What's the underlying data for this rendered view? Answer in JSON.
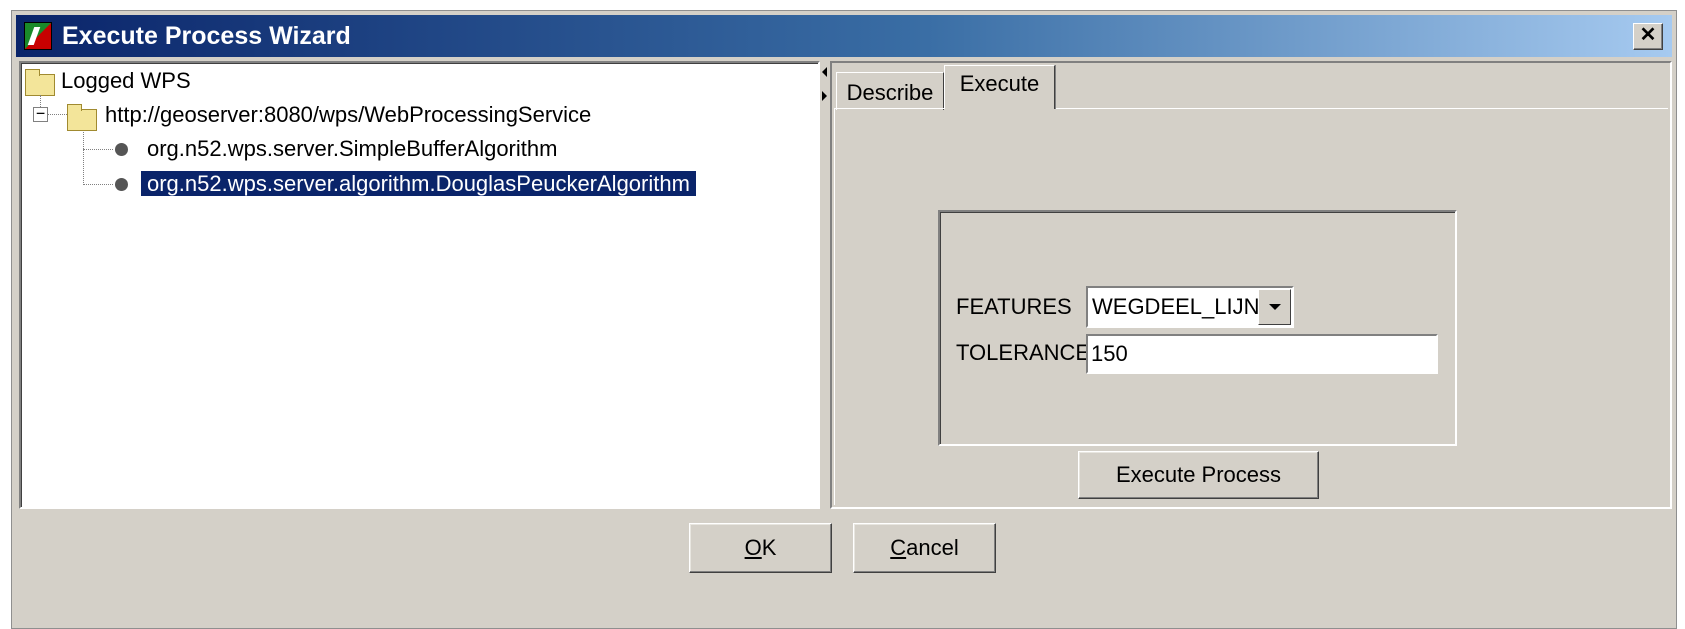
{
  "window": {
    "title": "Execute Process Wizard",
    "close_glyph": "✕"
  },
  "tree": {
    "root_label": "Logged WPS",
    "server_label": "http://geoserver:8080/wps/WebProcessingService",
    "expander_glyph": "−",
    "processes": [
      {
        "label": "org.n52.wps.server.SimpleBufferAlgorithm",
        "selected": false
      },
      {
        "label": "org.n52.wps.server.algorithm.DouglasPeuckerAlgorithm",
        "selected": true
      }
    ]
  },
  "tabs": [
    {
      "label": "Describe",
      "active": false
    },
    {
      "label": "Execute",
      "active": true
    }
  ],
  "execute_form": {
    "features_label": "FEATURES",
    "features_value": "WEGDEEL_LIJN",
    "tolerance_label": "TOLERANCE",
    "tolerance_value": "150",
    "execute_button_label": "Execute Process"
  },
  "footer": {
    "ok_mnemonic": "O",
    "ok_rest": "K",
    "cancel_mnemonic": "C",
    "cancel_rest": "ancel"
  },
  "colors": {
    "title_gradient_start": "#0a246a",
    "title_gradient_end": "#a6caf0",
    "face": "#d4d0c8",
    "selection": "#0a246a"
  },
  "icons": {
    "app": "red-green-app-icon",
    "folder": "folder-icon",
    "leaf": "process-node-icon",
    "close": "close-icon",
    "dropdown": "chevron-down-icon"
  }
}
